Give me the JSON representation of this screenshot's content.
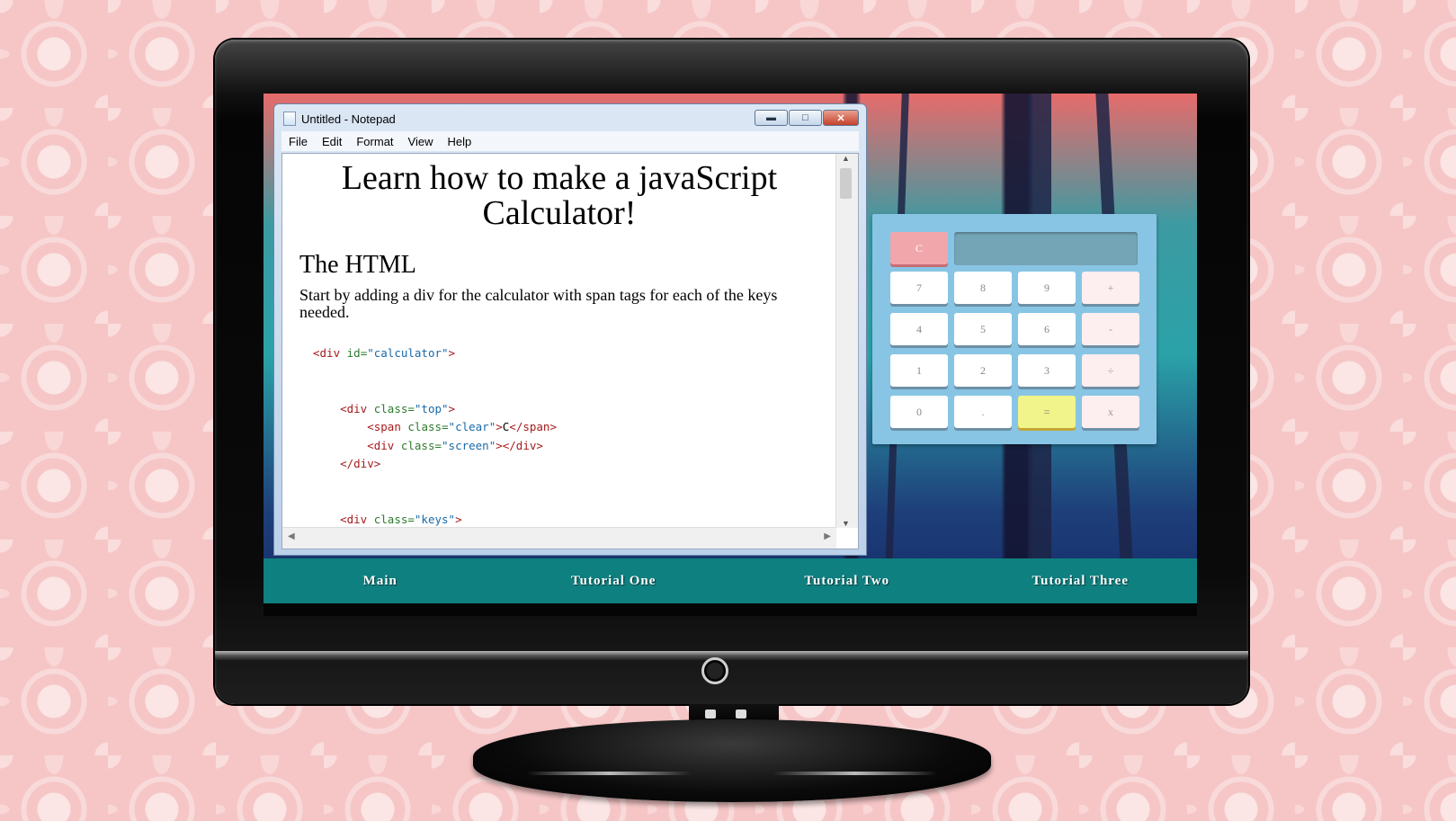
{
  "notepad": {
    "title": "Untitled - Notepad",
    "menu": [
      "File",
      "Edit",
      "Format",
      "View",
      "Help"
    ],
    "heading": "Learn how to make a javaScript Calculator!",
    "subheading": "The HTML",
    "paragraph": "Start by adding a div for the calculator with span tags for each of the keys needed."
  },
  "calculator": {
    "clear": "C",
    "rows": [
      [
        "7",
        "8",
        "9",
        "+"
      ],
      [
        "4",
        "5",
        "6",
        "-"
      ],
      [
        "1",
        "2",
        "3",
        "÷"
      ],
      [
        "0",
        ".",
        "=",
        "x"
      ]
    ]
  },
  "nav": [
    "Main",
    "Tutorial One",
    "Tutorial Two",
    "Tutorial Three"
  ],
  "colors": {
    "nav_bg": "#0f8080",
    "calc_bg": "#88c5e4",
    "clear_key": "#f1a6ab",
    "equals_key": "#f1f48a",
    "page_bg": "#f6c6c6"
  }
}
